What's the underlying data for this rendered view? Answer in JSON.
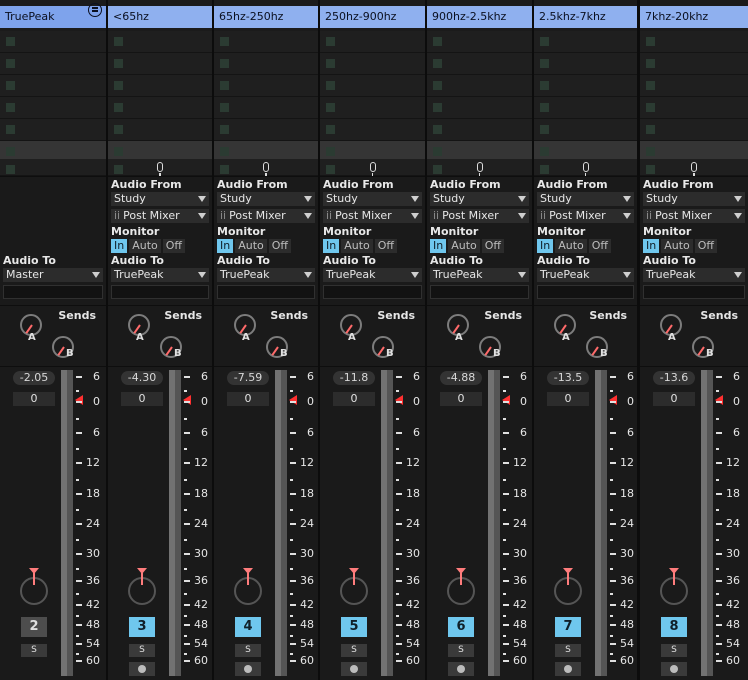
{
  "master_track": {
    "name": "TruePeak",
    "audio_to_label": "Audio To",
    "audio_to_value": "Master",
    "peak": "-2.05",
    "volume": "0",
    "number": "2",
    "solo": "S"
  },
  "tracks": [
    {
      "name": "<65hz",
      "peak": "-4.30",
      "volume": "0",
      "number": "3"
    },
    {
      "name": "65hz-250hz",
      "peak": "-7.59",
      "volume": "0",
      "number": "4"
    },
    {
      "name": "250hz-900hz",
      "peak": "-11.8",
      "volume": "0",
      "number": "5"
    },
    {
      "name": "900hz-2.5khz",
      "peak": "-4.88",
      "volume": "0",
      "number": "6"
    },
    {
      "name": "2.5khz-7khz",
      "peak": "-13.5",
      "volume": "0",
      "number": "7"
    },
    {
      "name": "7khz-20khz",
      "peak": "-13.6",
      "volume": "0",
      "number": "8"
    }
  ],
  "io": {
    "audio_from_label": "Audio From",
    "audio_from_value": "Study",
    "post_mixer_prefix": "ii",
    "post_mixer_value": "Post Mixer",
    "monitor_label": "Monitor",
    "monitor_in": "In",
    "monitor_auto": "Auto",
    "monitor_off": "Off",
    "audio_to_label": "Audio To",
    "audio_to_value": "TruePeak"
  },
  "sends": {
    "label": "Sends",
    "a": "A",
    "b": "B"
  },
  "solo_label": "S",
  "meter_scale": [
    "6",
    "0",
    "6",
    "12",
    "18",
    "24",
    "30",
    "36",
    "42",
    "48",
    "54",
    "60"
  ],
  "colors": {
    "header": "#8fb0ef",
    "active": "#6fc7ee",
    "marker": "#ff3030"
  }
}
